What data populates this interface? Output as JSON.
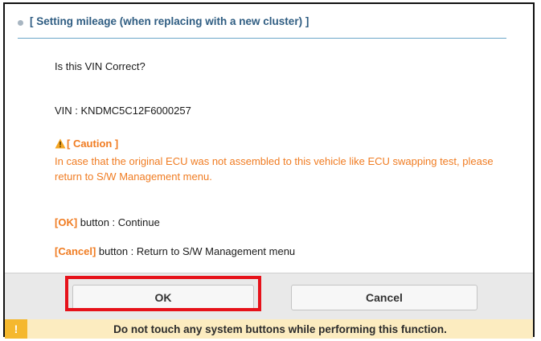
{
  "header": {
    "title": "[ Setting mileage (when replacing with a new cluster) ]"
  },
  "content": {
    "question": "Is this VIN Correct?",
    "vin": "VIN : KNDMC5C12F6000257",
    "caution_title": "[ Caution ]",
    "caution_body": "In case that the original ECU was not assembled to this vehicle like ECU swapping test, please return to S/W Management menu.",
    "ok_key": "[OK]",
    "ok_desc": " button : Continue",
    "cancel_key": "[Cancel]",
    "cancel_desc": " button : Return to S/W Management menu"
  },
  "buttons": {
    "ok": "OK",
    "cancel": "Cancel"
  },
  "warning_bar": {
    "icon": "!",
    "text": "Do not touch any system buttons while performing this function."
  },
  "colors": {
    "accent_orange": "#f07c22",
    "header_blue": "#2f5d82",
    "highlight_red": "#e6121a",
    "warning_bg": "#fcecc0",
    "warning_badge": "#f5b82e"
  }
}
